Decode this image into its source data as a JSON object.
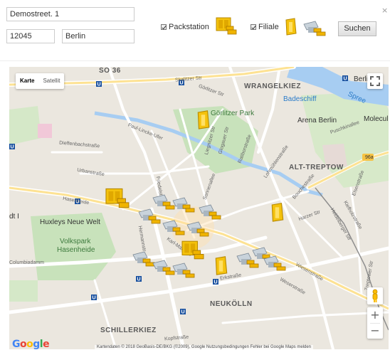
{
  "form": {
    "street_value": "Demostreet. 1",
    "zip_value": "12045",
    "city_value": "Berlin",
    "packstation_label": "Packstation",
    "filiale_label": "Filiale",
    "search_label": "Suchen",
    "close_glyph": "×"
  },
  "map": {
    "type_karte": "Karte",
    "type_satellit": "Satellit",
    "google_letters": [
      "G",
      "o",
      "o",
      "g",
      "l",
      "e"
    ],
    "google_colors": [
      "#4285f4",
      "#ea4335",
      "#fbbc05",
      "#4285f4",
      "#34a853",
      "#ea4335"
    ],
    "copyright": "Kartendaten © 2018 GeoBasis-DE/BKG (©2009), Google    Nutzungsbedingungen    Fehler bei Google Maps melden",
    "zoom_in": "+",
    "zoom_out": "−",
    "labels": {
      "so36": "SO 36",
      "wrangelkiez": "WRANGELKIEZ",
      "goerlitzer_park": "Görlitzer Park",
      "badeschiff": "Badeschiff",
      "arena": "Arena Berlin",
      "molecul": "Molecul",
      "alt_treptow": "ALT-TREPTOW",
      "huxleys": "Huxleys Neue Welt",
      "volkspark": "Volkspark",
      "hasenheide": "Hasenheide",
      "neukoelln": "NEUKÖLLN",
      "schillerkiez": "SCHILLERKIEZ",
      "spree": "Spree",
      "dt": "dt I",
      "columbia": "Columbiadamm",
      "b96a": "96a",
      "berlin_t": "Berlin T"
    },
    "streets": {
      "skalitzer": "Skalitzer Str",
      "goerlitzer_str": "Görlitzer Str",
      "paul_lincke": "Paul-Lincke-Ufer",
      "dieffenbach": "Dieffenbachstraße",
      "urban": "Urbanstraße",
      "hasenheide_str": "Hasenheide",
      "liegnitzer": "Liegnitzer Str",
      "glogauer": "Glogauer Str",
      "ratibor": "Ratiborstraße",
      "lohmuehlen": "Lohmühlenstraße",
      "puschkin": "Puschkinallee",
      "elsen": "Elsenstraße",
      "bouche": "Bouchestraße",
      "harzer": "Harzer Str",
      "heidelberger": "Heidelberger Str",
      "kiefholz": "Kiefholzstraße",
      "treptower": "Treptower Str",
      "wiesen": "Wiesenstraße",
      "weser": "Weserstraße",
      "erk": "Erkstraße",
      "karl_marx": "Karl-Marx-Str",
      "hermann": "Hermannstr",
      "friedel": "Friedelstr",
      "kopf": "Kopfstraße",
      "sonnen": "Sonnenallee"
    }
  }
}
